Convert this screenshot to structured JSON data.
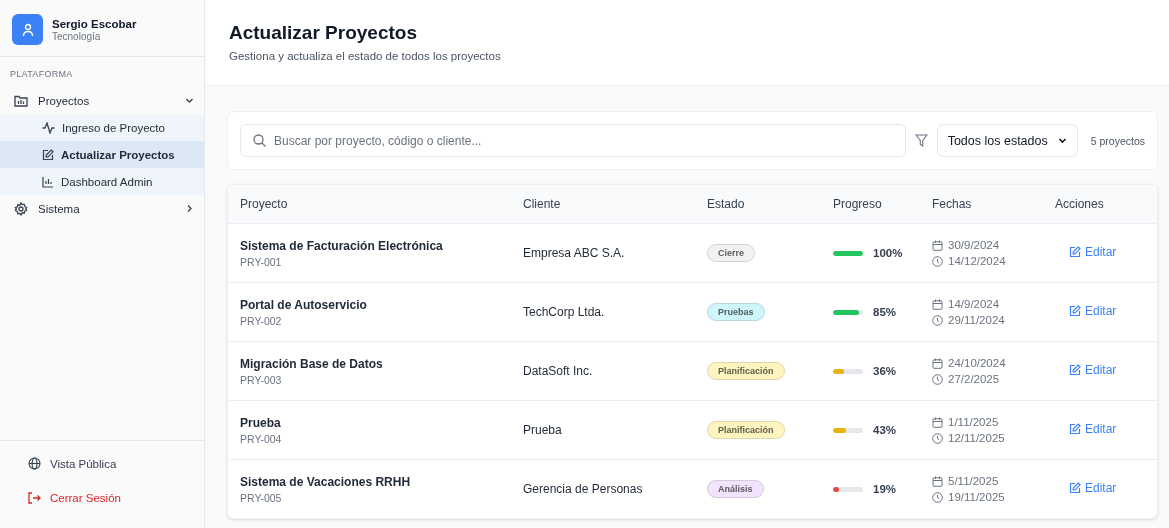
{
  "sidebar": {
    "user": {
      "name": "Sergio Escobar",
      "role": "Tecnología"
    },
    "section_label": "PLATAFORMA",
    "items": [
      {
        "label": "Proyectos",
        "expanded": true,
        "children": [
          {
            "label": "Ingreso de Proyecto",
            "selected": false
          },
          {
            "label": "Actualizar Proyectos",
            "selected": true
          },
          {
            "label": "Dashboard Admin",
            "selected": false
          }
        ]
      },
      {
        "label": "Sistema",
        "expanded": false
      }
    ],
    "footer": [
      {
        "label": "Vista Pública",
        "kind": "link"
      },
      {
        "label": "Cerrar Sesión",
        "kind": "logout"
      }
    ]
  },
  "page": {
    "title": "Actualizar Proyectos",
    "subtitle": "Gestiona y actualiza el estado de todos los proyectos"
  },
  "filters": {
    "search": {
      "placeholder": "Buscar por proyecto, código o cliente..."
    },
    "status_select": "Todos los estados",
    "count": "5 proyectos"
  },
  "table": {
    "columns": [
      "Proyecto",
      "Cliente",
      "Estado",
      "Progreso",
      "Fechas",
      "Acciones"
    ],
    "rows": [
      {
        "name": "Sistema de Facturación Electrónica",
        "code": "PRY-001",
        "client": "Empresa ABC S.A.",
        "status": {
          "label": "Cierre",
          "color": "#f0f1f3"
        },
        "level": 1,
        "reading": "100%",
        "start": "30/9/2024",
        "end": "14/12/2024",
        "action": "Editar"
      },
      {
        "name": "Portal de Autoservicio",
        "code": "PRY-002",
        "client": "TechCorp Ltda.",
        "status": {
          "label": "Pruebas",
          "color": "#cff7fb"
        },
        "level": 0.85,
        "reading": "85%",
        "start": "14/9/2024",
        "end": "29/11/2024",
        "action": "Editar"
      },
      {
        "name": "Migración Base de Datos",
        "code": "PRY-003",
        "client": "DataSoft Inc.",
        "status": {
          "label": "Planificación",
          "color": "#fdf4c0"
        },
        "level": 0.36,
        "reading": "36%",
        "start": "24/10/2024",
        "end": "27/2/2025",
        "action": "Editar"
      },
      {
        "name": "Prueba",
        "code": "PRY-004",
        "client": "Prueba",
        "status": {
          "label": "Planificación",
          "color": "#fdf4c0"
        },
        "level": 0.43,
        "reading": "43%",
        "start": "1/11/2025",
        "end": "12/11/2025",
        "action": "Editar"
      },
      {
        "name": "Sistema de Vacaciones RRHH",
        "code": "PRY-005",
        "client": "Gerencia de Personas",
        "status": {
          "label": "Análisis",
          "color": "#f1e4fc"
        },
        "level": 0.19,
        "reading": "19%",
        "start": "5/11/2025",
        "end": "19/11/2025",
        "action": "Editar"
      }
    ]
  }
}
